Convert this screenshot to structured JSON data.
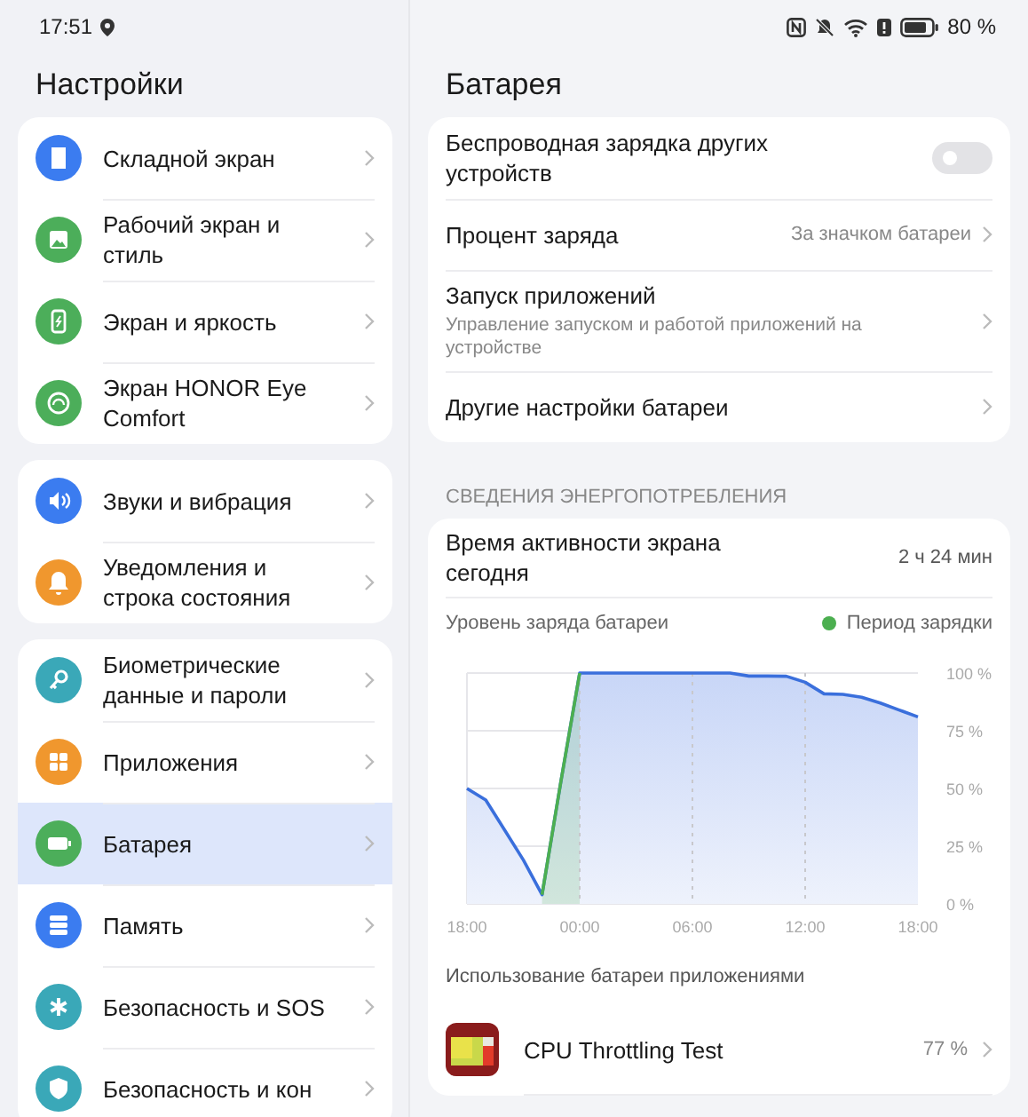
{
  "status_bar": {
    "time": "17:51",
    "battery_text": "80 %"
  },
  "sidebar": {
    "title": "Настройки",
    "groups": [
      {
        "items": [
          {
            "label": "Складной экран",
            "color": "#3b7cf0",
            "selected": false
          },
          {
            "label": "Рабочий экран и стиль",
            "color": "#4cae5a",
            "selected": false
          },
          {
            "label": "Экран и яркость",
            "color": "#4cae5a",
            "selected": false
          },
          {
            "label": "Экран HONOR Eye Comfort",
            "color": "#4cae5a",
            "selected": false
          }
        ]
      },
      {
        "items": [
          {
            "label": "Звуки и вибрация",
            "color": "#3b7cf0",
            "selected": false
          },
          {
            "label": "Уведомления и строка состояния",
            "color": "#f0972e",
            "selected": false
          }
        ]
      },
      {
        "items": [
          {
            "label": "Биометрические данные и пароли",
            "color": "#3aa8b8",
            "selected": false
          },
          {
            "label": "Приложения",
            "color": "#f0972e",
            "selected": false
          },
          {
            "label": "Батарея",
            "color": "#4cae5a",
            "selected": true
          },
          {
            "label": "Память",
            "color": "#3b7cf0",
            "selected": false
          },
          {
            "label": "Безопасность и SOS",
            "color": "#3aa8b8",
            "selected": false
          },
          {
            "label": "Безопасность и кон",
            "color": "#3aa8b8",
            "selected": false
          }
        ]
      }
    ]
  },
  "main": {
    "title": "Батарея",
    "settings": [
      {
        "kind": "toggle",
        "label": "Беспроводная зарядка других устройств",
        "on": false
      },
      {
        "kind": "value",
        "label": "Процент заряда",
        "value": "За значком батареи"
      },
      {
        "kind": "subtitle",
        "label": "Запуск приложений",
        "subtitle": "Управление запуском и работой приложений на устройстве"
      },
      {
        "kind": "link",
        "label": "Другие настройки батареи"
      }
    ],
    "section_header": "СВЕДЕНИЯ ЭНЕРГОПОТРЕБЛЕНИЯ",
    "screen_time": {
      "label": "Время активности экрана сегодня",
      "value": "2 ч 24 мин"
    },
    "chart_data": {
      "type": "area",
      "grid": true,
      "categories": [
        "18:00",
        null,
        null,
        null,
        null,
        null,
        "00:00",
        null,
        null,
        null,
        null,
        null,
        "06:00",
        null,
        null,
        null,
        null,
        null,
        "12:00",
        null,
        null,
        null,
        null,
        null,
        "18:00"
      ],
      "series": [
        {
          "name": "Уровень заряда батареи",
          "color": "#3a6fdc",
          "values": [
            50,
            45,
            32,
            19,
            4,
            53,
            100,
            100,
            100,
            100,
            100,
            100,
            100,
            100,
            100,
            98.7,
            98.7,
            98.6,
            96,
            91,
            90.8,
            89.5,
            87,
            84,
            81
          ]
        },
        {
          "name": "Период зарядки",
          "color": "#4caf50",
          "values": [
            null,
            null,
            null,
            null,
            4,
            53,
            100,
            null,
            null,
            null,
            null,
            null,
            null,
            null,
            null,
            null,
            null,
            null,
            null,
            null,
            null,
            null,
            null,
            null,
            null
          ]
        }
      ],
      "ylim": [
        0,
        100
      ],
      "yticks": [
        {
          "value": 0,
          "label": "0 %"
        },
        {
          "value": 25,
          "label": "25 %"
        },
        {
          "value": 50,
          "label": "50 %"
        },
        {
          "value": 75,
          "label": "75 %"
        },
        {
          "value": 100,
          "label": "100 %"
        }
      ]
    },
    "apps_header": "Использование батареи приложениями",
    "apps": [
      {
        "name": "CPU Throttling Test",
        "value": "77 %"
      }
    ]
  }
}
